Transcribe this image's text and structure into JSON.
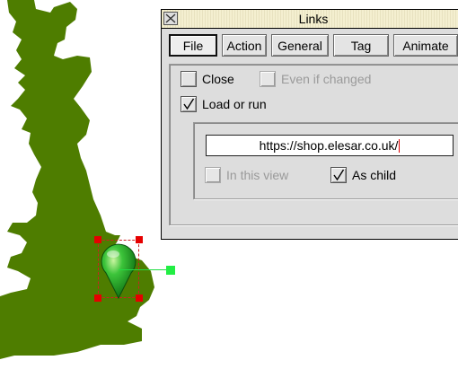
{
  "window": {
    "title": "Links",
    "tabs": [
      {
        "label": "File",
        "active": true
      },
      {
        "label": "Action",
        "active": false
      },
      {
        "label": "General",
        "active": false
      },
      {
        "label": "Tag",
        "active": false
      },
      {
        "label": "Animate",
        "active": false
      }
    ],
    "options": {
      "close": {
        "label": "Close",
        "checked": false
      },
      "even_if_changed": {
        "label": "Even if changed",
        "checked": false,
        "enabled": false
      },
      "load_or_run": {
        "label": "Load or run",
        "checked": true
      }
    },
    "url": {
      "value": "https://shop.elesar.co.uk/"
    },
    "in_this_view": {
      "label": "In this view",
      "checked": false,
      "enabled": false
    },
    "as_child": {
      "label": "As child",
      "checked": true
    }
  },
  "colors": {
    "map_fill": "#4e7d00",
    "pin": "#1aa51a",
    "selection_handle": "#e60000",
    "rotate_handle": "#22ee44"
  },
  "icons": {
    "close": "close-icon",
    "check": "check-icon",
    "pin": "map-pin-icon"
  }
}
